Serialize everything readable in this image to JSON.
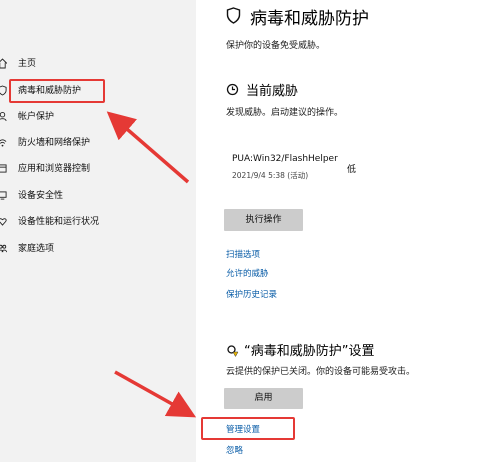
{
  "sidebar": {
    "items": [
      {
        "label": "主页",
        "icon": "home-icon"
      },
      {
        "label": "病毒和威胁防护",
        "icon": "shield-icon",
        "highlighted": true
      },
      {
        "label": "帐户保护",
        "icon": "person-icon"
      },
      {
        "label": "防火墙和网络保护",
        "icon": "wifi-icon"
      },
      {
        "label": "应用和浏览器控制",
        "icon": "app-browser-icon"
      },
      {
        "label": "设备安全性",
        "icon": "device-security-icon"
      },
      {
        "label": "设备性能和运行状况",
        "icon": "heart-icon"
      },
      {
        "label": "家庭选项",
        "icon": "family-icon"
      }
    ]
  },
  "page": {
    "title": "病毒和威胁防护",
    "subtitle": "保护你的设备免受威胁。"
  },
  "threats": {
    "heading": "当前威胁",
    "description": "发现威胁。启动建议的操作。",
    "threat_name": "PUA:Win32/FlashHelper",
    "threat_time": "2021/9/4 5:38 (活动)",
    "severity": "低",
    "action_button": "执行操作",
    "links": [
      "扫描选项",
      "允许的威胁",
      "保护历史记录"
    ]
  },
  "settings": {
    "heading": "“病毒和威胁防护”设置",
    "description": "云提供的保护已关闭。你的设备可能易受攻击。",
    "enable_button": "启用",
    "manage_link": "管理设置",
    "ignore_link": "忽略"
  },
  "colors": {
    "annotation": "#e53935",
    "link": "#0b5ea8",
    "sidebar_bg": "#f2f2f2",
    "button_bg": "#cccccc"
  }
}
